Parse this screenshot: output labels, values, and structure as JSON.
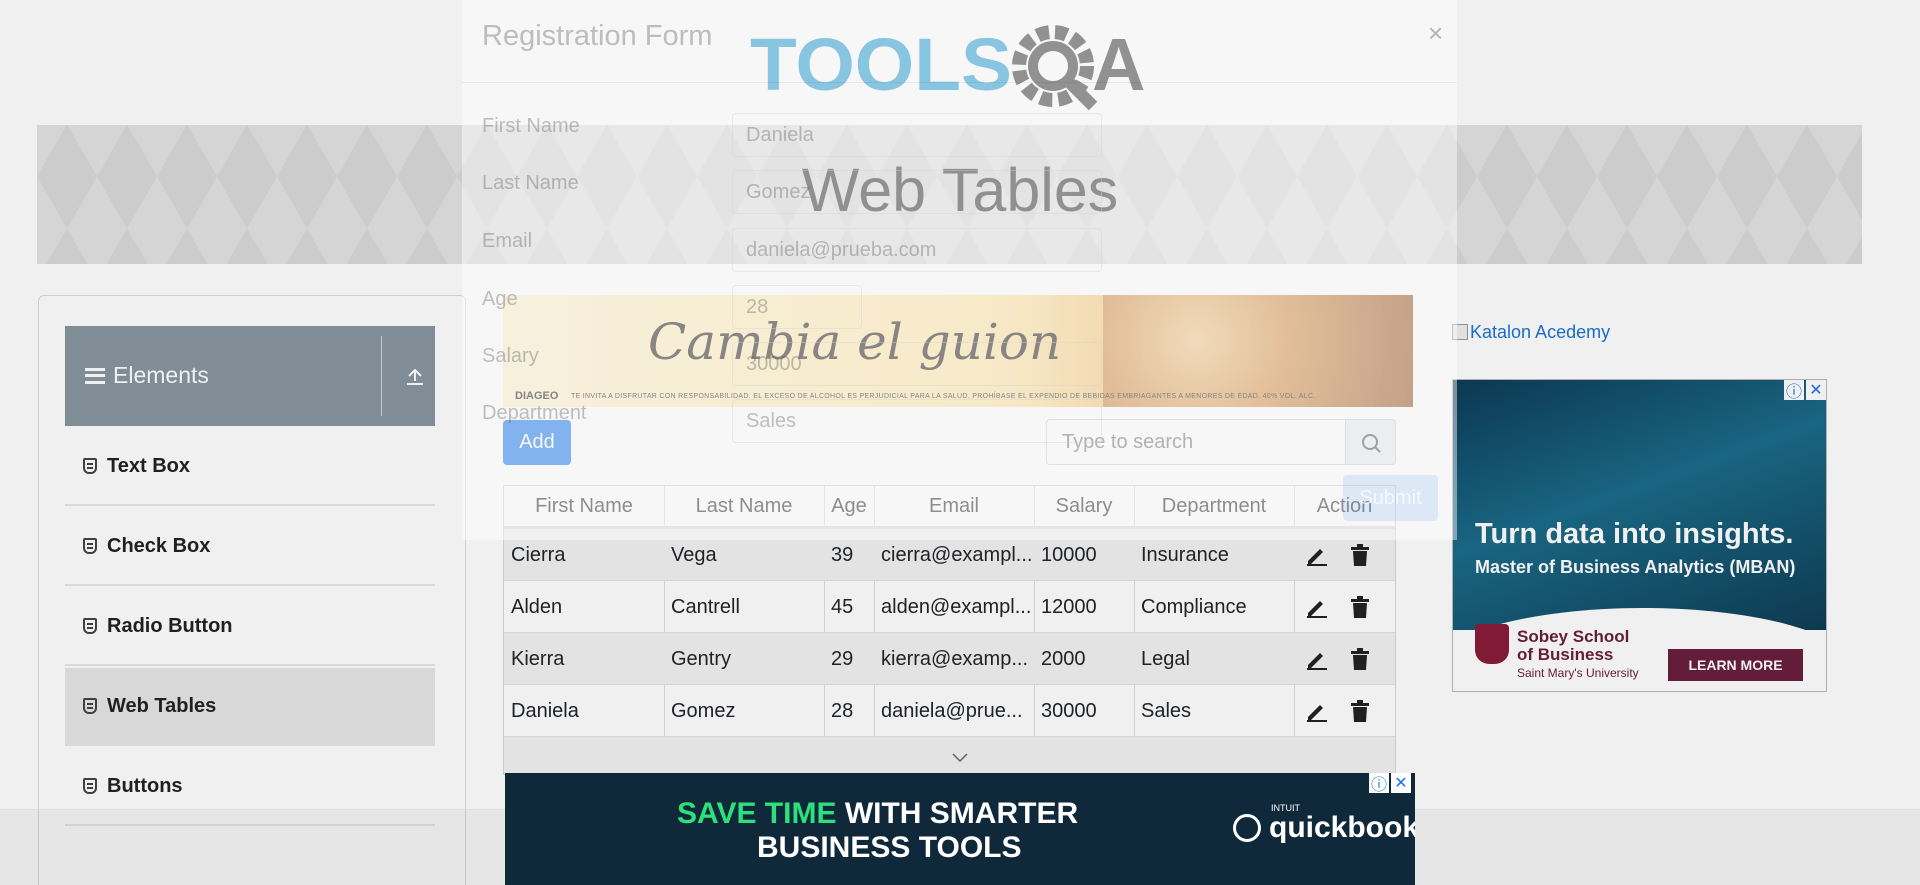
{
  "header": {
    "logo_text": "TOOLSQA",
    "page_title": "Web Tables"
  },
  "sidebar": {
    "group_title": "Elements",
    "items": [
      {
        "label": "Text Box",
        "active": false
      },
      {
        "label": "Check Box",
        "active": false
      },
      {
        "label": "Radio Button",
        "active": false
      },
      {
        "label": "Web Tables",
        "active": true
      },
      {
        "label": "Buttons",
        "active": false
      }
    ]
  },
  "toolbar": {
    "add_label": "Add",
    "search_placeholder": "Type to search"
  },
  "table": {
    "columns": [
      "First Name",
      "Last Name",
      "Age",
      "Email",
      "Salary",
      "Department",
      "Action"
    ],
    "rows": [
      [
        "Cierra",
        "Vega",
        "39",
        "cierra@exampl...",
        "10000",
        "Insurance"
      ],
      [
        "Alden",
        "Cantrell",
        "45",
        "alden@exampl...",
        "12000",
        "Compliance"
      ],
      [
        "Kierra",
        "Gentry",
        "29",
        "kierra@examp...",
        "2000",
        "Legal"
      ],
      [
        "Daniela",
        "Gomez",
        "28",
        "daniela@prue...",
        "30000",
        "Sales"
      ]
    ]
  },
  "modal": {
    "title": "Registration Form",
    "close": "×",
    "fields": [
      {
        "label": "First Name",
        "value": "Daniela"
      },
      {
        "label": "Last Name",
        "value": "Gomez"
      },
      {
        "label": "Email",
        "value": "daniela@prueba.com"
      },
      {
        "label": "Age",
        "value": "28"
      },
      {
        "label": "Salary",
        "value": "30000"
      },
      {
        "label": "Department",
        "value": "Sales"
      }
    ],
    "submit_label": "Submit"
  },
  "ads": {
    "cambia": {
      "slogan": "Cambia el guion",
      "brand": "DIAGEO",
      "legal": "TE INVITA A DISFRUTAR CON RESPONSABILIDAD. EL EXCESO DE ALCOHOL ES PERJUDICIAL PARA LA SALUD. PROHÍBASE EL EXPENDIO DE BEBIDAS EMBRIAGANTES A MENORES DE EDAD. 40% VOL. ALC."
    },
    "katalon_alt": "Katalon Acedemy",
    "mban": {
      "headline": "Turn data into insights.",
      "sub": "Master of Business Analytics (MBAN)",
      "school_1": "Sobey School",
      "school_2": "of Business",
      "uni": "Saint Mary's University",
      "cta": "LEARN MORE"
    },
    "quickbooks": {
      "line1_green": "SAVE TIME",
      "line1_white": "WITH SMARTER",
      "line2": "BUSINESS TOOLS",
      "brand": "quickbooks",
      "brand_small": "INTUIT"
    }
  },
  "colors": {
    "accent": "#1f7ef0",
    "sidebar_header": "#8a96a0",
    "logo_blue": "#2a9fd6",
    "logo_dark": "#3c3c3c"
  }
}
